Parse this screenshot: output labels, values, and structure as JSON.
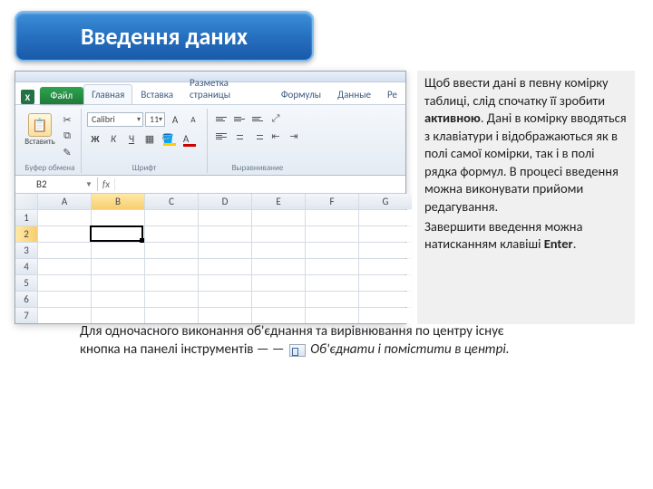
{
  "title": "Введення даних",
  "excel": {
    "app_icon": "X",
    "file_tab": "Файл",
    "tabs": [
      "Главная",
      "Вставка",
      "Разметка страницы",
      "Формулы",
      "Данные",
      "Ре"
    ],
    "paste_label": "Вставить",
    "clipboard_group": "Буфер обмена",
    "font_name": "Calibri",
    "font_size": "11",
    "font_group": "Шрифт",
    "align_group": "Выравнивание",
    "cell_ref": "B2",
    "fx": "fx",
    "cols": [
      "A",
      "B",
      "C",
      "D",
      "E",
      "F",
      "G"
    ],
    "rows": [
      "1",
      "2",
      "3",
      "4",
      "5",
      "6",
      "7"
    ]
  },
  "side": {
    "p1a": "Щоб ввести дані в певну комірку таблиці, слід спочатку її зробити ",
    "p1b": "активною",
    "p1c": ". Дані в комірку вводяться з клавіатури і відображаються як в полі самої комірки, так і в полі рядка формул. В процесі введення можна виконувати прийоми редагування.",
    "p2a": "Завершити введення можна натисканням клавіші ",
    "p2b": "Enter",
    "p2c": "."
  },
  "bottom": {
    "line1": "Для одночасного виконання об'єднання та вирівнювання по центру існує",
    "line2a": "кнопка на панелі інструментів — — ",
    "line2b": "Об'єднати і помістити в центрі."
  }
}
